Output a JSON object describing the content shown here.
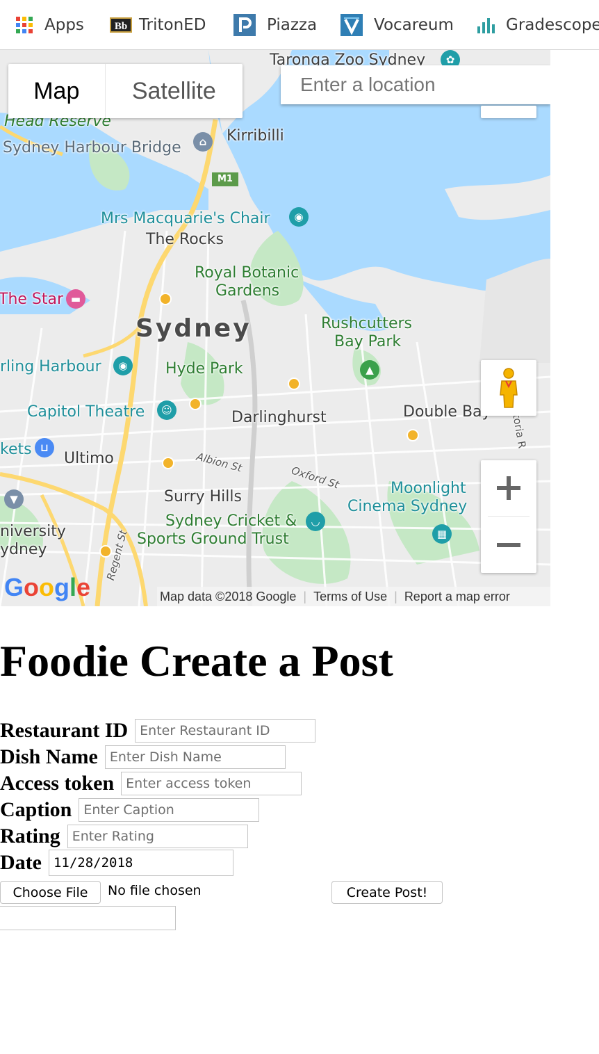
{
  "bookmarks": [
    {
      "label": "Apps",
      "icon": "apps-grid-icon"
    },
    {
      "label": "TritonED",
      "icon": "blackboard-icon"
    },
    {
      "label": "Piazza",
      "icon": "piazza-icon"
    },
    {
      "label": "Vocareum",
      "icon": "vocareum-icon"
    },
    {
      "label": "Gradescope",
      "icon": "gradescope-icon"
    }
  ],
  "map": {
    "type_map": "Map",
    "type_satellite": "Satellite",
    "search_placeholder": "Enter a location",
    "labels": {
      "taronga": "Taronga Zoo Sydney",
      "head_reserve": "Head Reserve",
      "harbour_bridge": "Sydney Harbour Bridge",
      "kirribilli": "Kirribilli",
      "m1": "M1",
      "macquarie": "Mrs Macquarie's Chair",
      "rocks": "The Rocks",
      "botanic_1": "Royal Botanic",
      "botanic_2": "Gardens",
      "the_star": "The Star",
      "sydney": "Sydney",
      "rushcutters_1": "Rushcutters",
      "rushcutters_2": "Bay Park",
      "darling_harbour": "rling Harbour",
      "hyde_park": "Hyde Park",
      "capitol": "Capitol Theatre",
      "darlinghurst": "Darlinghurst",
      "double_bay": "Double Bay",
      "victoria_road": "Victoria R",
      "kets": "kets",
      "ultimo": "Ultimo",
      "albion_st": "Albion St",
      "oxford_st": "Oxford St",
      "moonlight_1": "Moonlight",
      "moonlight_2": "Cinema Sydney",
      "surry_hills": "Surry Hills",
      "cricket_1": "Sydney Cricket &",
      "cricket_2": "Sports Ground Trust",
      "university_1": "niversity",
      "university_2": "ydney",
      "regent_st": "Regent St"
    },
    "google_logo": "Google",
    "footer_data": "Map data ©2018 Google",
    "footer_terms": "Terms of Use",
    "footer_report": "Report a map error"
  },
  "form": {
    "title": "Foodie Create a Post",
    "restaurant_id": {
      "label": "Restaurant ID",
      "placeholder": "Enter Restaurant ID"
    },
    "dish_name": {
      "label": "Dish Name",
      "placeholder": "Enter Dish Name"
    },
    "access_token": {
      "label": "Access token",
      "placeholder": "Enter access token"
    },
    "caption": {
      "label": "Caption",
      "placeholder": "Enter Caption"
    },
    "rating": {
      "label": "Rating",
      "placeholder": "Enter Rating"
    },
    "date": {
      "label": "Date",
      "value": "11/28/2018"
    },
    "choose_file": "Choose File",
    "no_file": "No file chosen",
    "submit": "Create Post!"
  },
  "colors": {
    "water": "#aadaff",
    "land": "#eeeeee",
    "park": "#c5e8c5",
    "highway": "#fdd870",
    "poi_teal": "#1f9ea8",
    "poi_orange": "#f2b32a"
  }
}
